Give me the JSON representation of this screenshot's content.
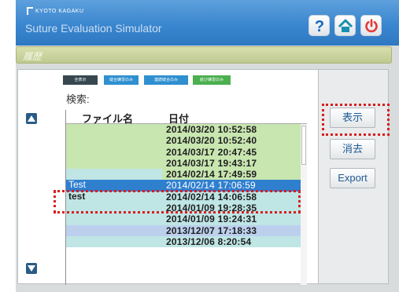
{
  "header": {
    "brand": "KYOTO KAGAKU",
    "title": "Suture Evaluation Simulator",
    "icons": [
      "help-icon",
      "home-icon",
      "power-icon"
    ]
  },
  "section": {
    "label": "履歴"
  },
  "filters": [
    {
      "label": "全表示",
      "color": "#37474f"
    },
    {
      "label": "縫合練習のみ",
      "color": "#2f8fd0"
    },
    {
      "label": "連続縫合のみ",
      "color": "#2f8fd0"
    },
    {
      "label": "結び練習のみ",
      "color": "#4caf50"
    }
  ],
  "search": {
    "label": "検索:"
  },
  "table": {
    "columns": [
      "ファイル名",
      "日付"
    ],
    "rows": [
      {
        "name": "",
        "date": "2014/03/20 10:52:58",
        "name_color": "#c8e6b0",
        "date_color": "#c8e6b0",
        "selected": false
      },
      {
        "name": "",
        "date": "2014/03/20 10:52:40",
        "name_color": "#c8e6b0",
        "date_color": "#c8e6b0",
        "selected": false
      },
      {
        "name": "",
        "date": "2014/03/17 20:47:45",
        "name_color": "#c8e6b0",
        "date_color": "#c8e6b0",
        "selected": false
      },
      {
        "name": "",
        "date": "2014/03/17 19:43:17",
        "name_color": "#c8e6b0",
        "date_color": "#c8e6b0",
        "selected": false
      },
      {
        "name": "",
        "date": "2014/02/14 17:49:59",
        "name_color": "#bfe5e5",
        "date_color": "#c8e6b0",
        "selected": false
      },
      {
        "name": "Test",
        "date": "2014/02/14 17:06:59",
        "name_color": "#2f7fcf",
        "date_color": "#2f7fcf",
        "selected": true
      },
      {
        "name": "test",
        "date": "2014/02/14 14:06:58",
        "name_color": "#bfe5e5",
        "date_color": "#bfe5e5",
        "selected": false
      },
      {
        "name": "",
        "date": "2014/01/09 19:28:35",
        "name_color": "#bfe5e5",
        "date_color": "#bfe5e5",
        "selected": false
      },
      {
        "name": "",
        "date": "2014/01/09 19:24:31",
        "name_color": "#bfe5e5",
        "date_color": "#bfe5e5",
        "selected": false
      },
      {
        "name": "",
        "date": "2013/12/07 17:18:33",
        "name_color": "#bcd0ee",
        "date_color": "#bcd0ee",
        "selected": false
      },
      {
        "name": "",
        "date": "2013/12/06 8:20:54",
        "name_color": "#bfe5e5",
        "date_color": "#bfe5e5",
        "selected": false
      }
    ]
  },
  "buttons": {
    "show": "表示",
    "delete": "消去",
    "export": "Export"
  },
  "colors": {
    "header": "#3a86cf",
    "accent": "#2f7fcf",
    "highlight": "#d81e1e"
  }
}
